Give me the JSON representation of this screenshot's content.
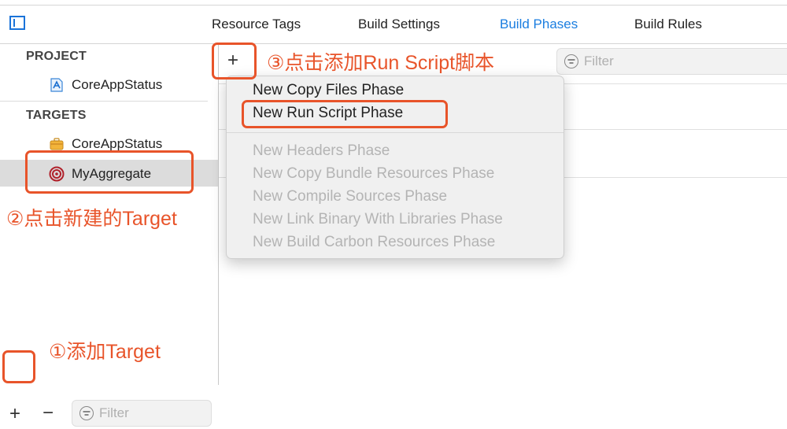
{
  "toolbar": {
    "sidebar_toggle_icon": "sidebar-panel-icon"
  },
  "tabs": [
    {
      "label": "Resource Tags"
    },
    {
      "label": "Build Settings"
    },
    {
      "label": "Build Phases",
      "active": true
    },
    {
      "label": "Build Rules"
    }
  ],
  "sidebar": {
    "project_header": "PROJECT",
    "project_item": {
      "label": "CoreAppStatus",
      "icon": "app-project-icon"
    },
    "targets_header": "TARGETS",
    "targets": [
      {
        "label": "CoreAppStatus",
        "icon": "toolbox-target-icon"
      },
      {
        "label": "MyAggregate",
        "icon": "aggregate-target-icon",
        "selected": true
      }
    ],
    "bottom": {
      "add_icon": "+",
      "remove_icon": "−",
      "filter_placeholder": "Filter"
    }
  },
  "main": {
    "add_phase_icon": "+",
    "filter_placeholder": "Filter"
  },
  "phase_menu": {
    "enabled_items": [
      "New Copy Files Phase",
      "New Run Script Phase"
    ],
    "disabled_items": [
      "New Headers Phase",
      "New Copy Bundle Resources Phase",
      "New Compile Sources Phase",
      "New Link Binary With Libraries Phase",
      "New Build Carbon Resources Phase"
    ]
  },
  "annotations": {
    "step1": "①添加Target",
    "step2": "②点击新建的Target",
    "step3": "③点击添加Run Script脚本"
  },
  "colors": {
    "accent": "#1b7ee0",
    "annotation": "#e8542a",
    "selection": "#dcdcdc"
  }
}
